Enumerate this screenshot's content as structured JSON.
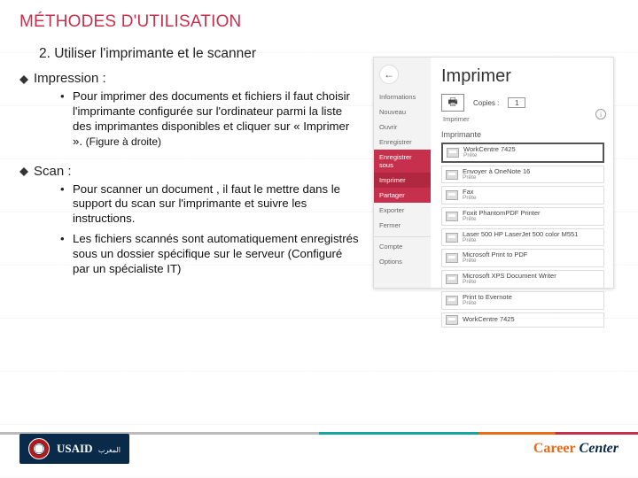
{
  "title": "MÉTHODES D'UTILISATION",
  "subtitle": "2.  Utiliser l'imprimante et le scanner",
  "sections": {
    "impression": {
      "label": "Impression :",
      "bullet1_a": "Pour imprimer des documents et fichiers il faut choisir l'imprimante configurée sur l'ordinateur parmi la liste des imprimantes disponibles et cliquer sur « Imprimer ». ",
      "bullet1_b": "(Figure à droite)"
    },
    "scan": {
      "label": "Scan :",
      "bullet1": "Pour scanner un document , il faut le mettre dans le support du scan sur l'imprimante et suivre les instructions.",
      "bullet2": "Les fichiers scannés sont automatiquement enregistrés sous un dossier spécifique sur le serveur (Configuré par un spécialiste IT)"
    }
  },
  "dialog": {
    "side": {
      "informations": "Informations",
      "nouveau": "Nouveau",
      "ouvrir": "Ouvrir",
      "enregistrer": "Enregistrer",
      "enregistrer_sous": "Enregistrer sous",
      "imprimer": "Imprimer",
      "partager": "Partager",
      "exporter": "Exporter",
      "fermer": "Fermer",
      "compte": "Compte",
      "options": "Options"
    },
    "main_title": "Imprimer",
    "copies_label": "Copies :",
    "copies_value": "1",
    "print_button": "Imprimer",
    "printer_header": "Imprimante",
    "printers": [
      {
        "name": "WorkCentre 7425",
        "status": "Prête",
        "sel": true
      },
      {
        "name": "Envoyer à OneNote 16",
        "status": "Prête"
      },
      {
        "name": "Fax",
        "status": "Prête"
      },
      {
        "name": "Foxit PhantomPDF Printer",
        "status": "Prête"
      },
      {
        "name": "Laser 500 HP LaserJet 500 color M551",
        "status": "Prête"
      },
      {
        "name": "Microsoft Print to PDF",
        "status": "Prête"
      },
      {
        "name": "Microsoft XPS Document Writer",
        "status": "Prête"
      },
      {
        "name": "Print to Evernote",
        "status": "Prête"
      },
      {
        "name": "WorkCentre 7425",
        "status": ""
      }
    ]
  },
  "footer": {
    "usaid": "USAID",
    "wm": "المغرب",
    "brand_left": "Career",
    "brand_right": " Center"
  }
}
